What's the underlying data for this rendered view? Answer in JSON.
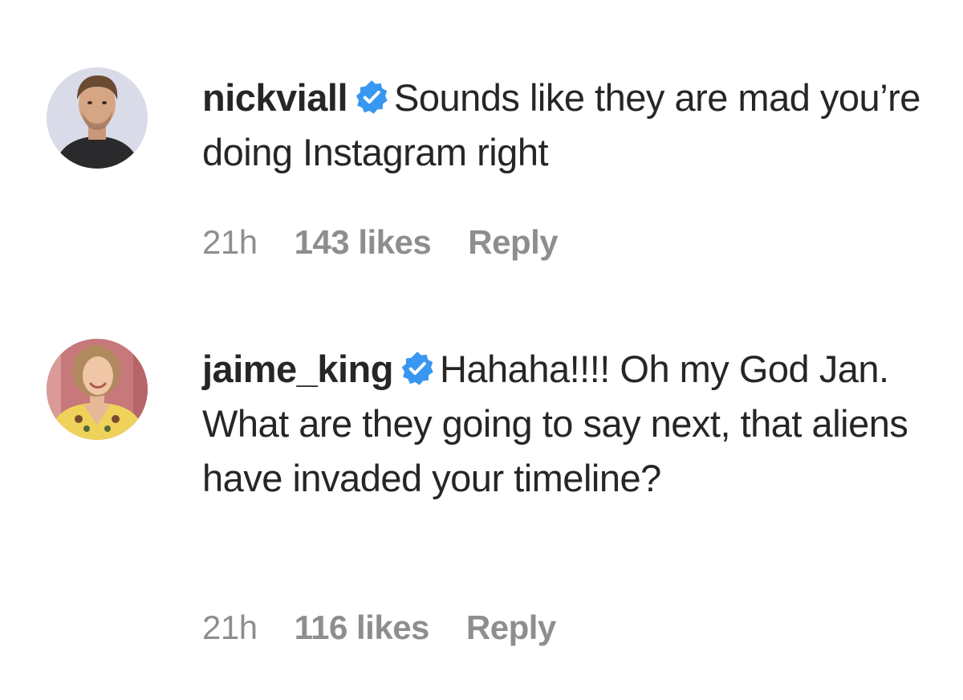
{
  "comments": [
    {
      "username": "nickviall",
      "verified": true,
      "text": "Sounds like they are mad you’re doing Instagram right",
      "time": "21h",
      "likes": "143 likes",
      "reply_label": "Reply"
    },
    {
      "username": "jaime_king",
      "verified": true,
      "text": "Hahaha!!!! Oh my God Jan. What are they going to say next, that aliens have invaded your timeline?",
      "time": "21h",
      "likes": "116 likes",
      "reply_label": "Reply"
    }
  ],
  "colors": {
    "text": "#262626",
    "meta": "#8e8e8e",
    "verified_badge": "#3897f0"
  },
  "icons": {
    "verified": "verified-badge-icon"
  }
}
